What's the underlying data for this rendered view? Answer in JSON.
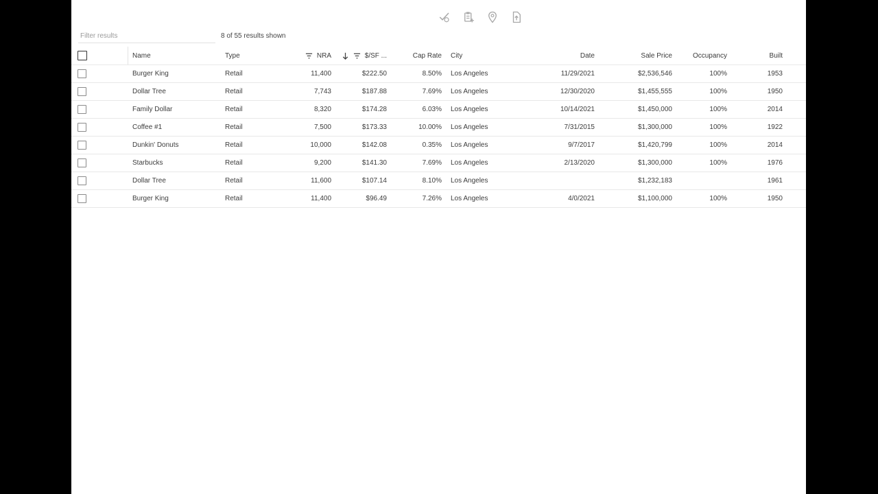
{
  "toolbar": {
    "icons": [
      "approve-check-icon",
      "clipboard-add-icon",
      "map-pin-icon",
      "export-file-icon"
    ]
  },
  "filter": {
    "placeholder": "Filter results",
    "value": "",
    "count_text": "8 of 55 results shown"
  },
  "table": {
    "columns": {
      "name": "Name",
      "type": "Type",
      "nra": "NRA",
      "psf": "$/SF ...",
      "cap": "Cap Rate",
      "city": "City",
      "date": "Date",
      "price": "Sale Price",
      "occ": "Occupancy",
      "built": "Built"
    },
    "sort": {
      "column": "psf",
      "direction": "descending"
    },
    "filtered_columns": [
      "nra",
      "psf"
    ],
    "rows": [
      {
        "name": "Burger King",
        "type": "Retail",
        "nra": "11,400",
        "psf": "$222.50",
        "cap": "8.50%",
        "city": "Los Angeles",
        "date": "11/29/2021",
        "price": "$2,536,546",
        "occ": "100%",
        "built": "1953"
      },
      {
        "name": "Dollar Tree",
        "type": "Retail",
        "nra": "7,743",
        "psf": "$187.88",
        "cap": "7.69%",
        "city": "Los Angeles",
        "date": "12/30/2020",
        "price": "$1,455,555",
        "occ": "100%",
        "built": "1950"
      },
      {
        "name": "Family Dollar",
        "type": "Retail",
        "nra": "8,320",
        "psf": "$174.28",
        "cap": "6.03%",
        "city": "Los Angeles",
        "date": "10/14/2021",
        "price": "$1,450,000",
        "occ": "100%",
        "built": "2014"
      },
      {
        "name": "Coffee #1",
        "type": "Retail",
        "nra": "7,500",
        "psf": "$173.33",
        "cap": "10.00%",
        "city": "Los Angeles",
        "date": "7/31/2015",
        "price": "$1,300,000",
        "occ": "100%",
        "built": "1922"
      },
      {
        "name": "Dunkin' Donuts",
        "type": "Retail",
        "nra": "10,000",
        "psf": "$142.08",
        "cap": "0.35%",
        "city": "Los Angeles",
        "date": "9/7/2017",
        "price": "$1,420,799",
        "occ": "100%",
        "built": "2014"
      },
      {
        "name": "Starbucks",
        "type": "Retail",
        "nra": "9,200",
        "psf": "$141.30",
        "cap": "7.69%",
        "city": "Los Angeles",
        "date": "2/13/2020",
        "price": "$1,300,000",
        "occ": "100%",
        "built": "1976"
      },
      {
        "name": "Dollar Tree",
        "type": "Retail",
        "nra": "11,600",
        "psf": "$107.14",
        "cap": "8.10%",
        "city": "Los Angeles",
        "date": "",
        "price": "$1,232,183",
        "occ": "",
        "built": "1961"
      },
      {
        "name": "Burger King",
        "type": "Retail",
        "nra": "11,400",
        "psf": "$96.49",
        "cap": "7.26%",
        "city": "Los Angeles",
        "date": "4/0/2021",
        "price": "$1,100,000",
        "occ": "100%",
        "built": "1950"
      }
    ]
  },
  "colors": {
    "background": "#000000",
    "panel": "#ffffff",
    "row_border": "#e8e8e8",
    "icon": "#9e9e9e"
  }
}
